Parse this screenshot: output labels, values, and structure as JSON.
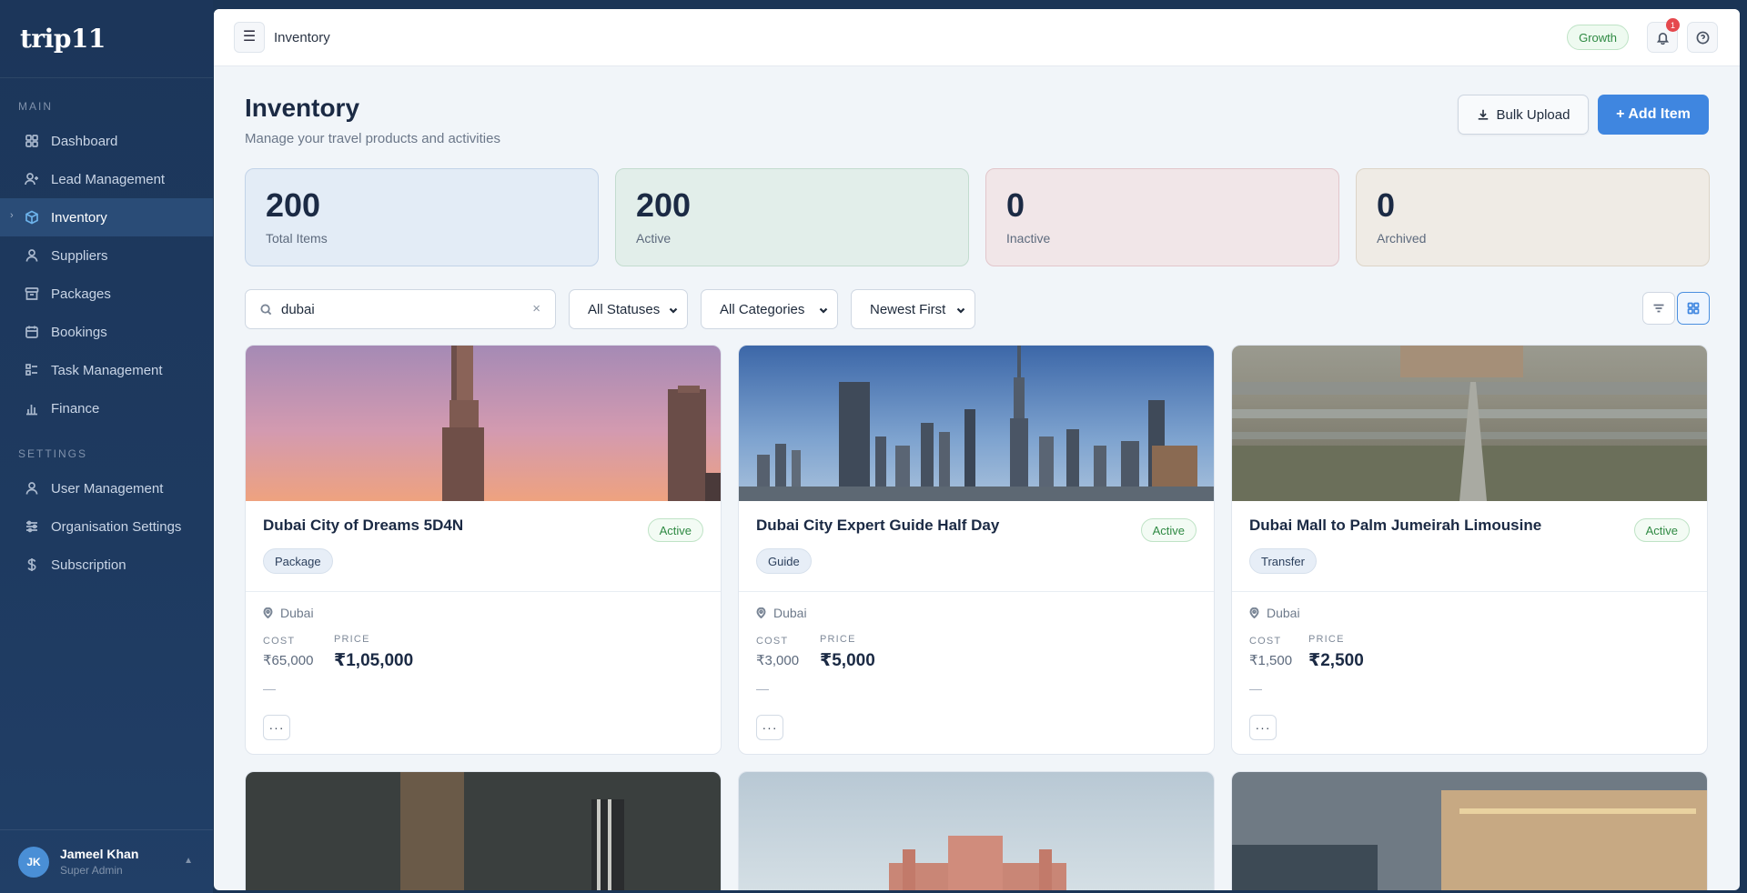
{
  "brand": {
    "name": "trip11"
  },
  "sidebar": {
    "main_header": "MAIN",
    "settings_header": "SETTINGS",
    "main_items": [
      {
        "label": "Dashboard",
        "icon": "grid-icon"
      },
      {
        "label": "Lead Management",
        "icon": "user-plus-icon"
      },
      {
        "label": "Inventory",
        "icon": "box-icon",
        "active": true
      },
      {
        "label": "Suppliers",
        "icon": "user-icon"
      },
      {
        "label": "Packages",
        "icon": "archive-icon"
      },
      {
        "label": "Bookings",
        "icon": "calendar-icon"
      },
      {
        "label": "Task Management",
        "icon": "tasks-icon"
      },
      {
        "label": "Finance",
        "icon": "bar-chart-icon"
      }
    ],
    "settings_items": [
      {
        "label": "User Management",
        "icon": "user-icon"
      },
      {
        "label": "Organisation Settings",
        "icon": "sliders-icon"
      },
      {
        "label": "Subscription",
        "icon": "dollar-icon"
      }
    ],
    "user": {
      "initials": "JK",
      "name": "Jameel Khan",
      "role": "Super Admin"
    }
  },
  "topbar": {
    "title": "Inventory",
    "plan": "Growth",
    "notification_count": "1"
  },
  "page": {
    "title": "Inventory",
    "subtitle": "Manage your travel products and activities",
    "bulk_upload_label": "Bulk Upload",
    "add_item_label": "+ Add Item"
  },
  "stats": [
    {
      "value": "200",
      "label": "Total Items"
    },
    {
      "value": "200",
      "label": "Active"
    },
    {
      "value": "0",
      "label": "Inactive"
    },
    {
      "value": "0",
      "label": "Archived"
    }
  ],
  "filters": {
    "search_value": "dubai",
    "status": "All Statuses",
    "category": "All Categories",
    "sort": "Newest First"
  },
  "labels": {
    "cost": "COST",
    "price": "PRICE"
  },
  "items": [
    {
      "name": "Dubai City of Dreams 5D4N",
      "status": "Active",
      "category": "Package",
      "location": "Dubai",
      "cost": "₹65,000",
      "price": "₹1,05,000",
      "note": "—"
    },
    {
      "name": "Dubai City Expert Guide Half Day",
      "status": "Active",
      "category": "Guide",
      "location": "Dubai",
      "cost": "₹3,000",
      "price": "₹5,000",
      "note": "—"
    },
    {
      "name": "Dubai Mall to Palm Jumeirah Limousine",
      "status": "Active",
      "category": "Transfer",
      "location": "Dubai",
      "cost": "₹1,500",
      "price": "₹2,500",
      "note": "—"
    }
  ],
  "colors": {
    "accent": "#3f86e0",
    "sidebar": "#1c365a",
    "success": "#2f8a43"
  }
}
